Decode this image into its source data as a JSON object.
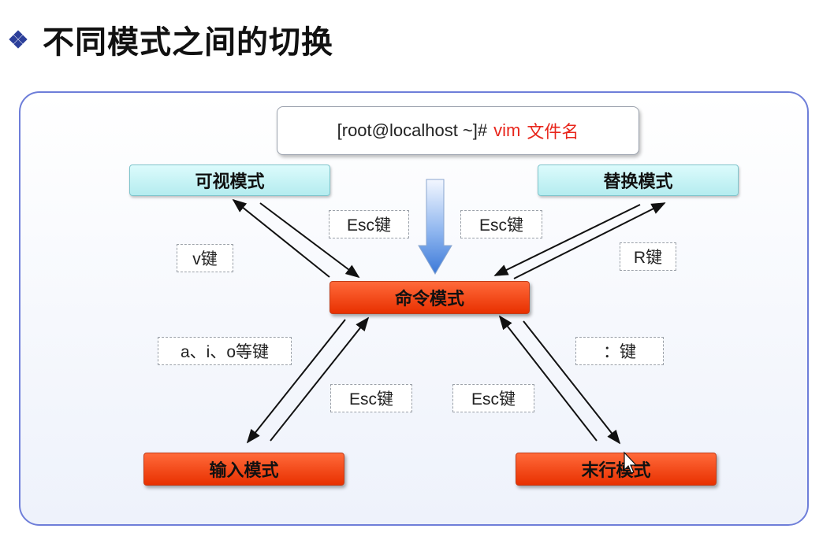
{
  "slide": {
    "title": "不同模式之间的切换"
  },
  "command": {
    "prompt": "[root@localhost ~]#",
    "vim": "vim",
    "filename": "文件名"
  },
  "modes": {
    "visual": "可视模式",
    "replace": "替换模式",
    "command": "命令模式",
    "insert": "输入模式",
    "lastline": "末行模式"
  },
  "keys": {
    "esc_visual": "Esc键",
    "esc_replace": "Esc键",
    "v": "v键",
    "r": "R键",
    "insert_keys": "a、i、o等键",
    "colon": "：键",
    "esc_insert": "Esc键",
    "esc_lastline": "Esc键"
  }
}
